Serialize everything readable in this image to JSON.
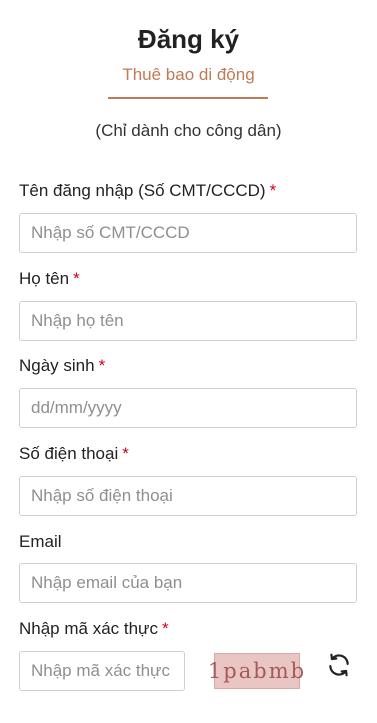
{
  "header": {
    "title": "Đăng ký",
    "tab_label": "Thuê bao di động",
    "subtitle": "(Chỉ dành cho công dân)"
  },
  "form": {
    "username": {
      "label": "Tên đăng nhập (Số CMT/CCCD)",
      "required": "*",
      "placeholder": "Nhập số CMT/CCCD",
      "value": ""
    },
    "fullname": {
      "label": "Họ tên",
      "required": "*",
      "placeholder": "Nhập họ tên",
      "value": ""
    },
    "birthday": {
      "label": "Ngày sinh",
      "required": "*",
      "placeholder": "dd/mm/yyyy",
      "value": ""
    },
    "phone": {
      "label": "Số điện thoại",
      "required": "*",
      "placeholder": "Nhập số điện thoại",
      "value": ""
    },
    "email": {
      "label": "Email",
      "placeholder": "Nhập email của bạn",
      "value": ""
    },
    "captcha": {
      "label": "Nhập mã xác thực",
      "required": "*",
      "placeholder": "Nhập mã xác thực",
      "code": "1pabmb",
      "value": ""
    }
  },
  "colors": {
    "accent": "#c07a55",
    "required": "#d0021b",
    "border": "#cfcfcf"
  },
  "icons": {
    "refresh": "refresh-icon"
  }
}
